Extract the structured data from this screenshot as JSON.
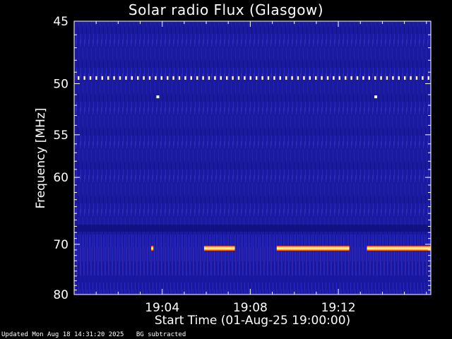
{
  "chart_data": {
    "type": "heatmap",
    "title": "Solar radio Flux (Glasgow)",
    "xlabel": "Start Time (01-Aug-25 19:00:00)",
    "ylabel": "Frequency [MHz]",
    "x_range_minutes": [
      0,
      16.2
    ],
    "x_ticks": [
      {
        "minute": 4,
        "label": "19:04"
      },
      {
        "minute": 8,
        "label": "19:08"
      },
      {
        "minute": 12,
        "label": "19:12"
      }
    ],
    "ylim": [
      45,
      80
    ],
    "y_ticks": [
      {
        "value": 45,
        "label": "45"
      },
      {
        "value": 50,
        "label": "50"
      },
      {
        "value": 55,
        "label": "55"
      },
      {
        "value": 60,
        "label": "60"
      },
      {
        "value": 70,
        "label": "70"
      },
      {
        "value": 80,
        "label": "80"
      }
    ],
    "background_color": "#1a1aa0",
    "features": [
      {
        "kind": "dotted_band",
        "frequency_mhz": 49.5,
        "start_minute": 0,
        "end_minute": 16.2
      },
      {
        "kind": "spot",
        "frequency_mhz": 51.2,
        "minute": 3.8
      },
      {
        "kind": "spot",
        "frequency_mhz": 51.2,
        "minute": 13.7
      },
      {
        "kind": "emission_band",
        "frequency_mhz": 70.7,
        "start_minute": 3.5,
        "end_minute": 3.6
      },
      {
        "kind": "emission_band",
        "frequency_mhz": 70.7,
        "start_minute": 5.9,
        "end_minute": 7.3
      },
      {
        "kind": "emission_band",
        "frequency_mhz": 70.7,
        "start_minute": 9.2,
        "end_minute": 12.5
      },
      {
        "kind": "emission_band",
        "frequency_mhz": 70.7,
        "start_minute": 13.3,
        "end_minute": 16.2
      }
    ],
    "grid": false
  },
  "footer": {
    "updated": "Updated Mon Aug 18 14:31:20 2025",
    "note": "BG subtracted"
  }
}
